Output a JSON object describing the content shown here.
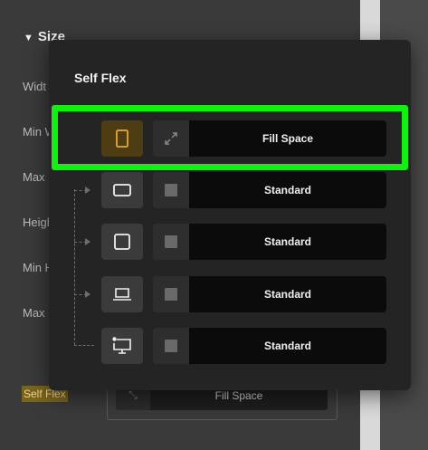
{
  "background": {
    "section_title": "Size",
    "labels": [
      "Widt",
      "Min W",
      "Max",
      "Heigh",
      "Min H",
      "Max"
    ],
    "self_flex_label": "Self Flex",
    "self_flex_value": "Fill Space"
  },
  "popup": {
    "title": "Self Flex",
    "rows": [
      {
        "device": "phone",
        "mode": "Fill Space",
        "active": true
      },
      {
        "device": "tablet-landscape",
        "mode": "Standard",
        "active": false
      },
      {
        "device": "tablet",
        "mode": "Standard",
        "active": false
      },
      {
        "device": "laptop",
        "mode": "Standard",
        "active": false
      },
      {
        "device": "desktop",
        "mode": "Standard",
        "active": false
      }
    ]
  },
  "colors": {
    "highlight": "#12f012",
    "active_device": "#4e3d12",
    "accent_icon": "#e8a93a"
  }
}
